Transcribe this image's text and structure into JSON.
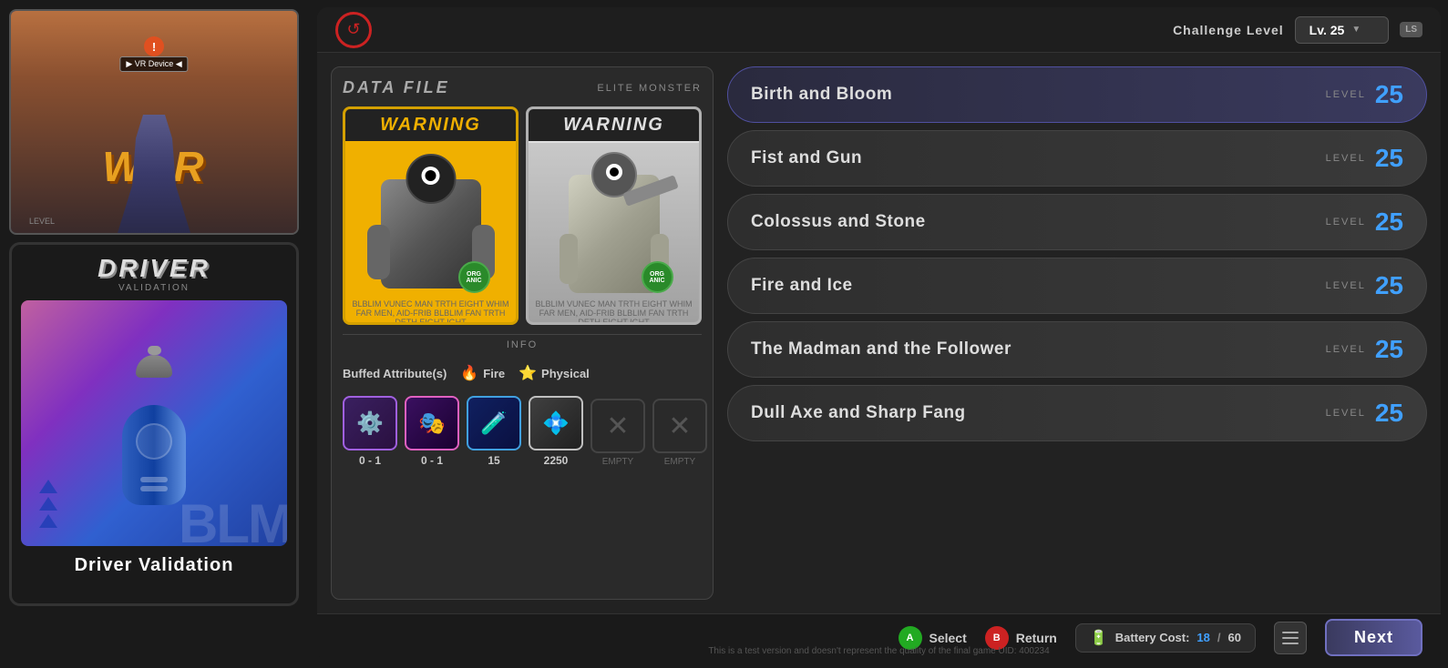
{
  "left_panel": {
    "game_title": "WAR",
    "vr_label": "VR",
    "vr_device_label": "▶ VR Device ◀",
    "driver_card": {
      "title": "DRIVER",
      "subtitle": "VALIDATION",
      "card_name": "Driver Validation"
    }
  },
  "top_bar": {
    "challenge_label": "Challenge Level",
    "level_value": "Lv. 25",
    "ls_badge": "LS"
  },
  "data_file": {
    "title": "DATA FILE",
    "elite_label": "ELITE MONSTER",
    "info_tab": "INFO",
    "buffed_label": "Buffed Attribute(s)",
    "attributes": [
      "Fire",
      "Physical"
    ],
    "loadout": [
      {
        "label": "0 - 1",
        "type": "purple"
      },
      {
        "label": "0 - 1",
        "type": "pink"
      },
      {
        "label": "15",
        "type": "blue"
      },
      {
        "label": "2250",
        "type": "white"
      },
      {
        "label": "EMPTY",
        "type": "empty"
      },
      {
        "label": "EMPTY",
        "type": "empty"
      }
    ]
  },
  "missions": [
    {
      "name": "Birth and Bloom",
      "level_label": "LEVEL",
      "level": "25",
      "selected": true
    },
    {
      "name": "Fist and Gun",
      "level_label": "LEVEL",
      "level": "25",
      "selected": false
    },
    {
      "name": "Colossus and Stone",
      "level_label": "LEVEL",
      "level": "25",
      "selected": false
    },
    {
      "name": "Fire and Ice",
      "level_label": "LEVEL",
      "level": "25",
      "selected": false
    },
    {
      "name": "The Madman and the Follower",
      "level_label": "LEVEL",
      "level": "25",
      "selected": false
    },
    {
      "name": "Dull Axe and Sharp Fang",
      "level_label": "LEVEL",
      "level": "25",
      "selected": false
    }
  ],
  "bottom_bar": {
    "select_label": "Select",
    "return_label": "Return",
    "battery_label": "Battery Cost:",
    "battery_current": "18",
    "battery_total": "60",
    "next_label": "Next"
  },
  "disclaimer": "This is a test version and doesn't represent the quality of the final game UID: 400234"
}
